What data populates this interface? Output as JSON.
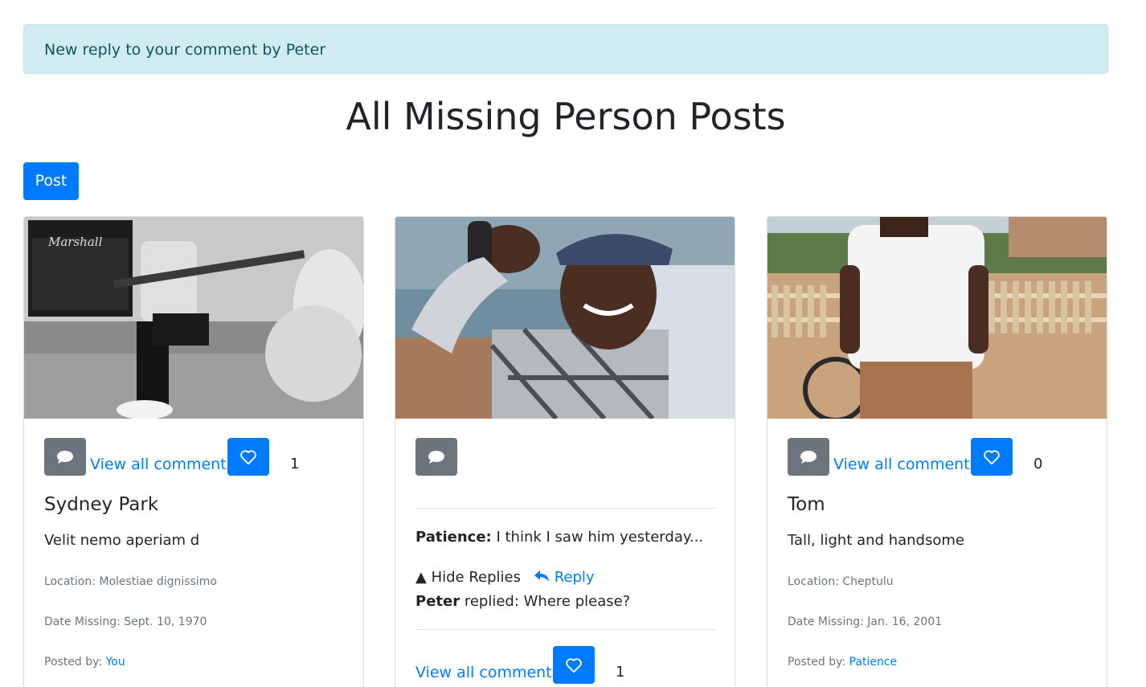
{
  "alert": {
    "text": "New reply to your comment by Peter"
  },
  "page": {
    "title": "All Missing Person Posts",
    "post_button": "Post"
  },
  "cards": [
    {
      "view_comments": "View all comments",
      "likes": "1",
      "name": "Sydney Park",
      "description": "Velit nemo aperiam d",
      "location_label": "Location:",
      "location": "Molestiae dignissimo",
      "date_label": "Date Missing:",
      "date": "Sept. 10, 1970",
      "posted_label": "Posted by:",
      "posted_by": "You"
    },
    {
      "comment": {
        "author": "Patience:",
        "text": "I think I saw him yesterday..."
      },
      "hide_replies": "▲ Hide Replies",
      "reply": "Reply",
      "replies": [
        {
          "author": "Peter",
          "text": "replied: Where please?"
        }
      ],
      "view_comments": "View all comments",
      "likes": "1"
    },
    {
      "view_comments": "View all comments",
      "likes": "0",
      "name": "Tom",
      "description": "Tall, light and handsome",
      "location_label": "Location:",
      "location": "Cheptulu",
      "date_label": "Date Missing:",
      "date": "Jan. 16, 2001",
      "posted_label": "Posted by:",
      "posted_by": "Patience"
    }
  ],
  "colors": {
    "primary": "#007bff",
    "secondary": "#6c757d",
    "alert_bg": "#d1ecf1",
    "alert_text": "#0c5460"
  },
  "icons": {
    "comment": "comment-icon",
    "like": "heart-icon",
    "reply": "reply-arrow-icon"
  }
}
